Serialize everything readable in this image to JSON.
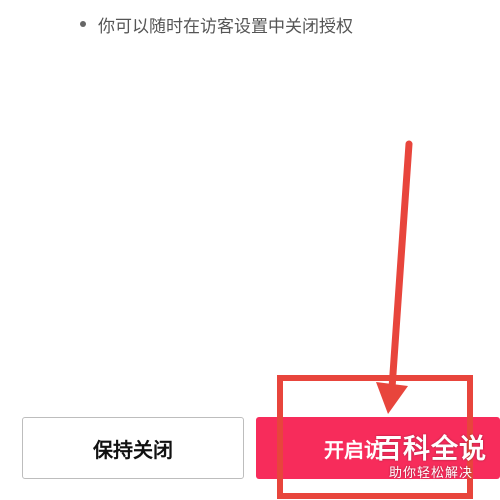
{
  "info": {
    "text": "你可以随时在访客设置中关闭授权"
  },
  "buttons": {
    "keep_closed_label": "保持关闭",
    "open_label": "开启访"
  },
  "colors": {
    "primary_button": "#f72c5b",
    "annotation": "#e8453c"
  },
  "watermark": {
    "main": "百科全说",
    "sub": "助你轻松解决"
  }
}
